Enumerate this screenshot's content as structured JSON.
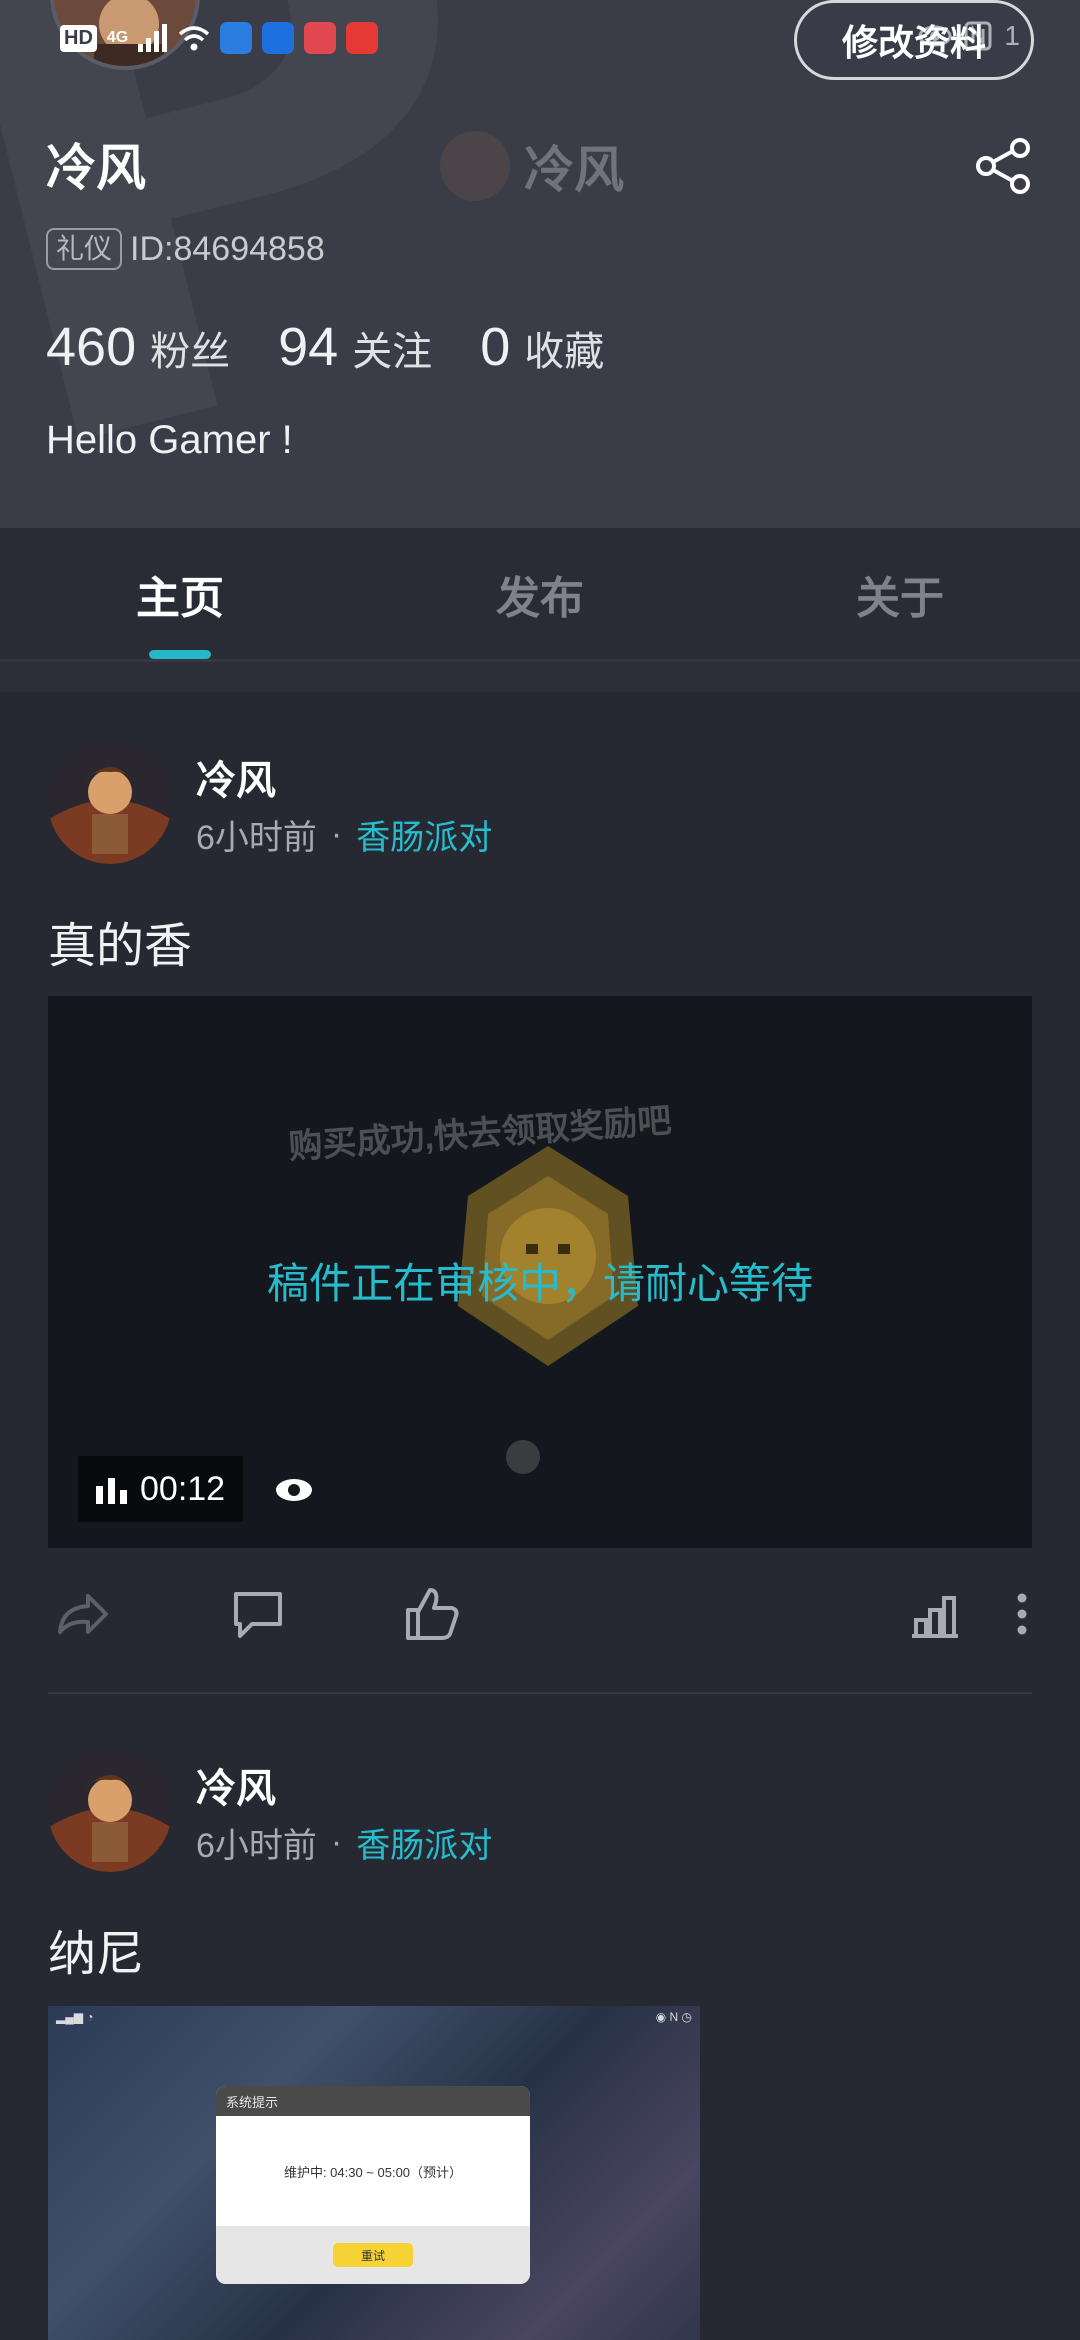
{
  "status_bar": {
    "hd": "HD",
    "network": "4G",
    "right_digit": "1"
  },
  "profile": {
    "edit_label": "修改资料",
    "name": "冷风",
    "role_badge": "礼仪",
    "id_text": "ID:84694858",
    "stats": [
      {
        "num": "460",
        "label": "粉丝"
      },
      {
        "num": "94",
        "label": "关注"
      },
      {
        "num": "0",
        "label": "收藏"
      }
    ],
    "bio": "Hello Gamer !"
  },
  "tabs": [
    {
      "label": "主页",
      "active": true
    },
    {
      "label": "发布",
      "active": false
    },
    {
      "label": "关于",
      "active": false
    }
  ],
  "posts": [
    {
      "author": "冷风",
      "time": "6小时前",
      "topic": "香肠派对",
      "text": "真的香",
      "video": {
        "bg_text": "购买成功,快去领取奖励吧",
        "status": "稿件正在审核中，请耐心等待",
        "duration": "00:12"
      }
    },
    {
      "author": "冷风",
      "time": "6小时前",
      "topic": "香肠派对",
      "text": "纳尼",
      "screenshot": {
        "dialog_title": "系统提示",
        "dialog_message": "维护中: 04:30 ~ 05:00（预计）",
        "dialog_button": "重试"
      }
    }
  ],
  "colors": {
    "accent": "#26bccb",
    "background": "#262832",
    "header": "#3a3d48"
  }
}
